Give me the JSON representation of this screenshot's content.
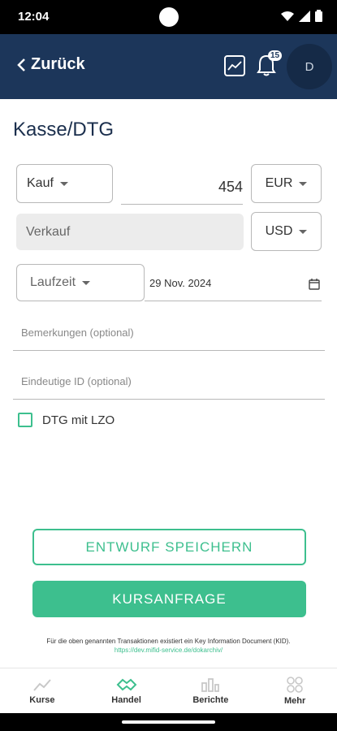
{
  "status": {
    "time": "12:04"
  },
  "header": {
    "back_label": "Zurück",
    "notification_count": "15",
    "avatar_initial": "D"
  },
  "page": {
    "title": "Kasse/DTG"
  },
  "form": {
    "side_label": "Kauf",
    "amount": "454",
    "currency_buy": "EUR",
    "counter_side_label": "Verkauf",
    "currency_sell": "USD",
    "tenor_label": "Laufzeit",
    "date": "29 Nov. 2024",
    "remarks_placeholder": "Bemerkungen (optional)",
    "unique_id_placeholder": "Eindeutige ID (optional)",
    "dtg_lzo_label": "DTG mit LZO",
    "dtg_lzo_checked": false
  },
  "actions": {
    "save_draft_label": "ENTWURF SPEICHERN",
    "request_quote_label": "KURSANFRAGE"
  },
  "notice": {
    "text": "Für die oben genannten Transaktionen existiert ein Key Information Document (KID).",
    "link": "https://dev.mifid-service.de/dokarchiv/"
  },
  "nav": {
    "items": [
      {
        "label": "Kurse"
      },
      {
        "label": "Handel"
      },
      {
        "label": "Berichte"
      },
      {
        "label": "Mehr"
      }
    ]
  },
  "colors": {
    "header_bg": "#1c365a",
    "accent": "#3dbf8e"
  }
}
